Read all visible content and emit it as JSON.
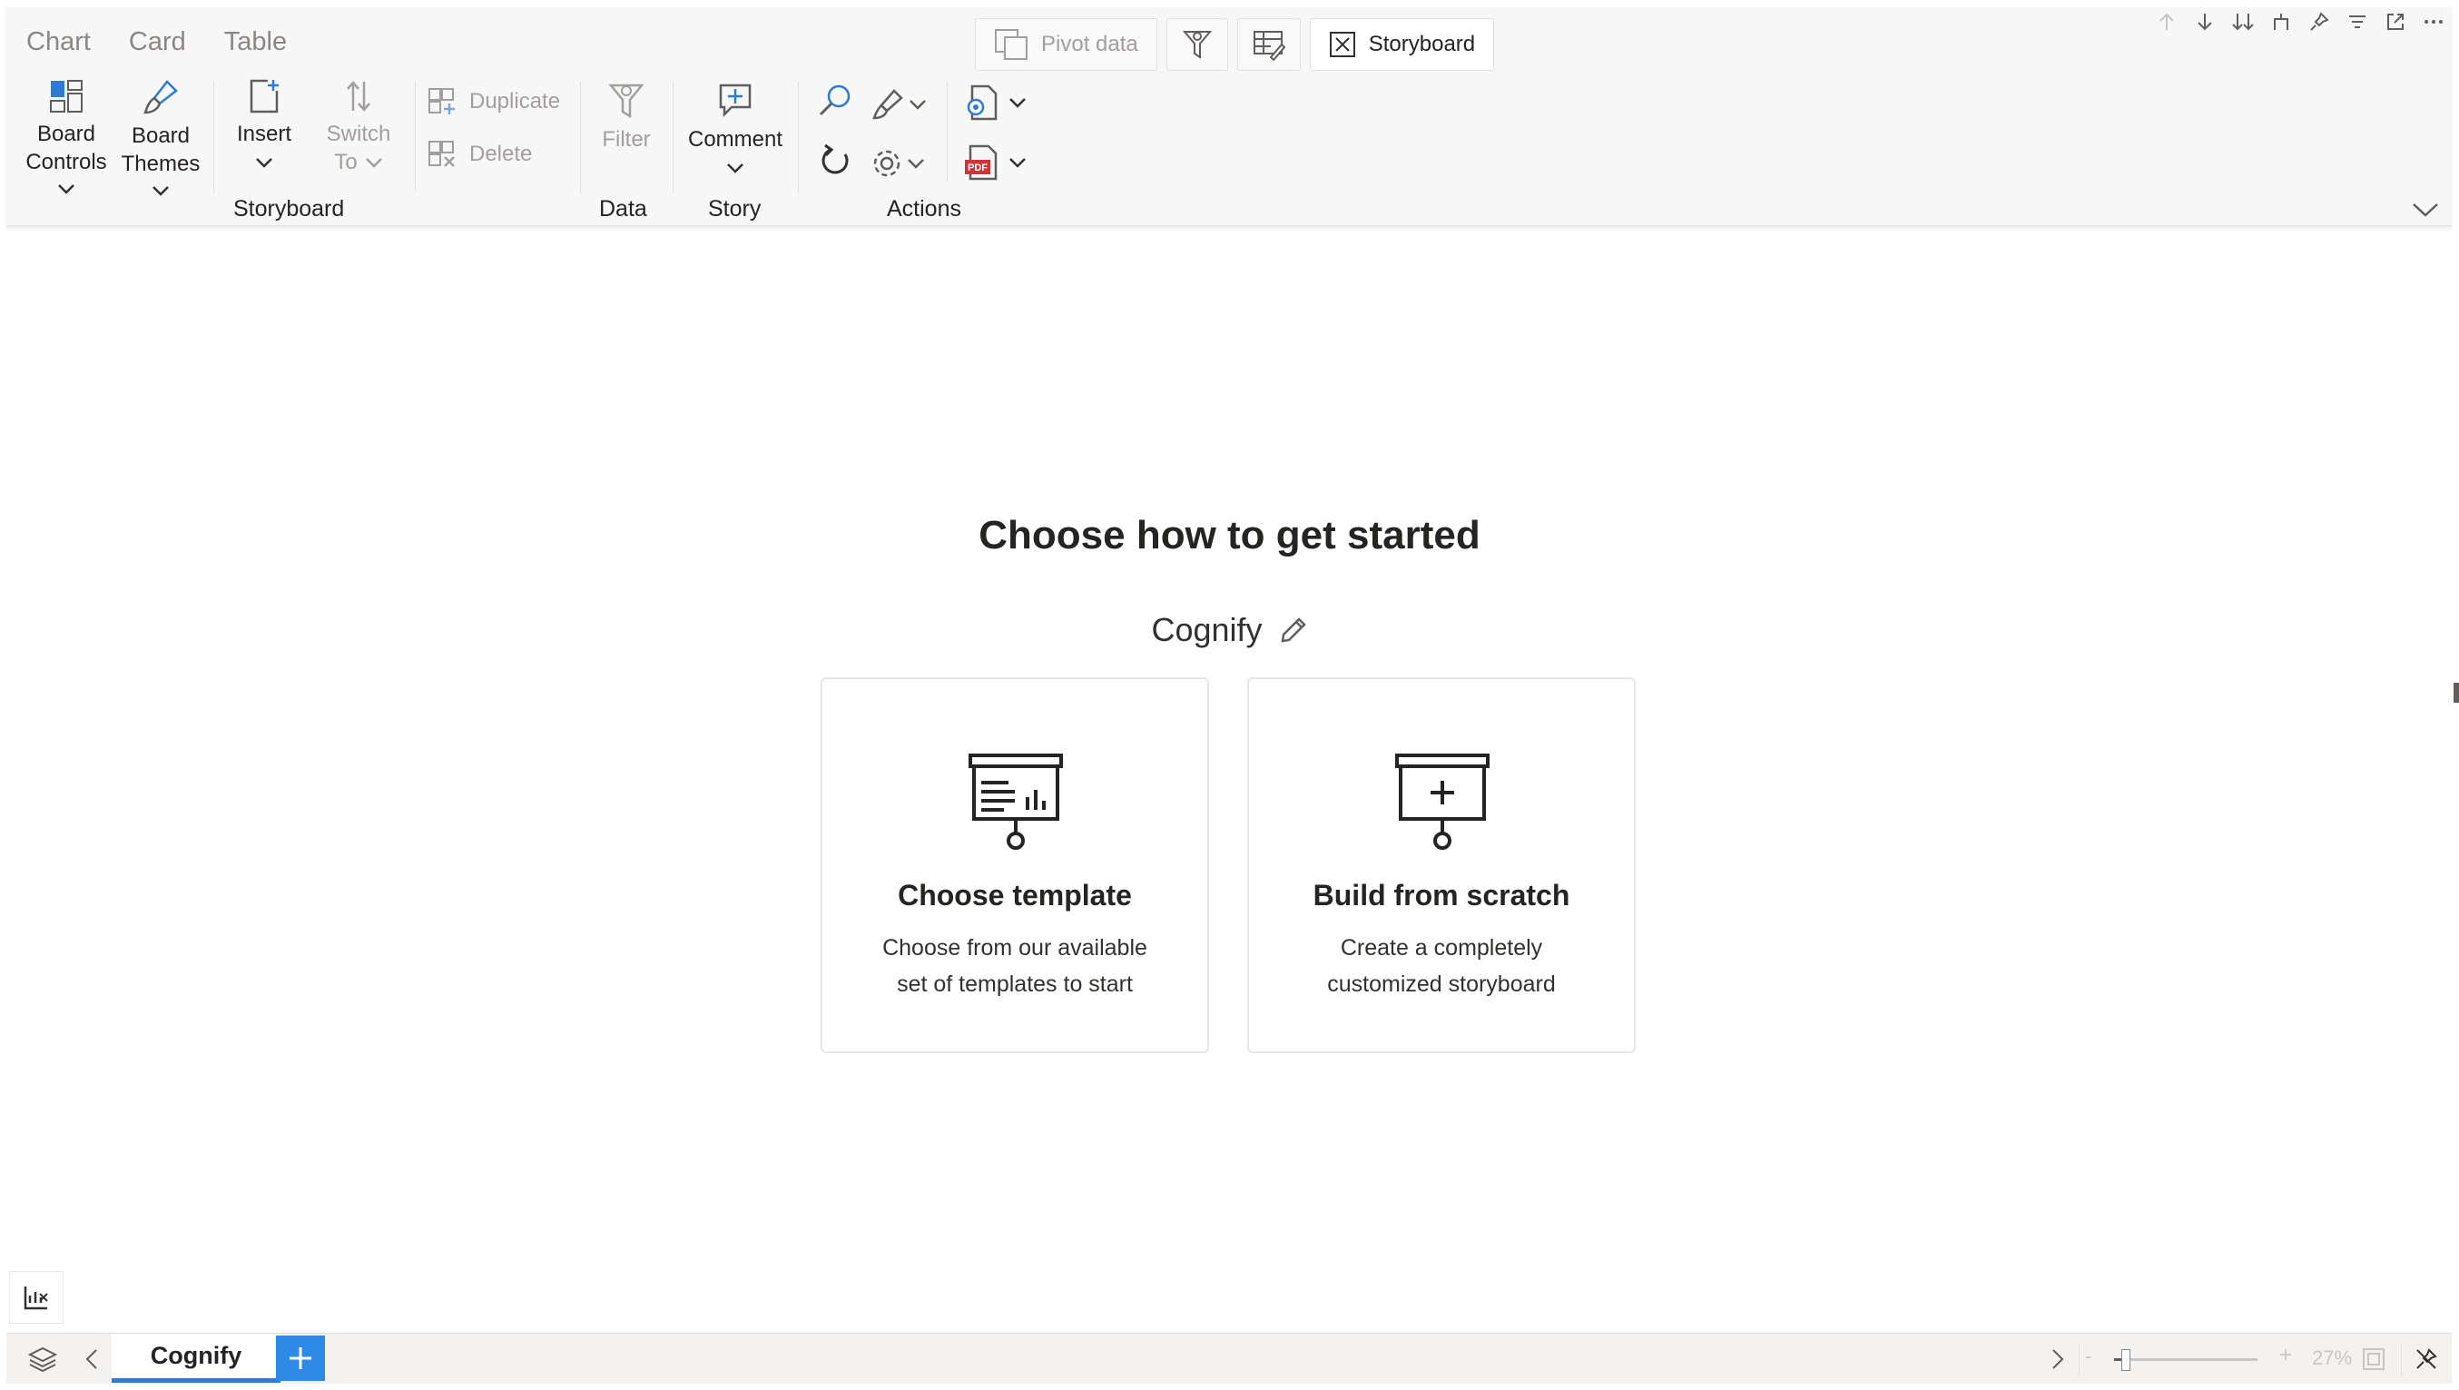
{
  "top_tabs": [
    "Chart",
    "Card",
    "Table"
  ],
  "center_tools": {
    "pivot_label": "Pivot data",
    "storyboard_label": "Storyboard"
  },
  "ribbon": {
    "board_controls": [
      "Board",
      "Controls"
    ],
    "board_themes": [
      "Board",
      "Themes"
    ],
    "insert": "Insert",
    "switch_to": [
      "Switch",
      "To"
    ],
    "duplicate": "Duplicate",
    "delete": "Delete",
    "filter": "Filter",
    "comment": "Comment",
    "groups": {
      "storyboard": "Storyboard",
      "data": "Data",
      "story": "Story",
      "actions": "Actions"
    }
  },
  "main": {
    "heading": "Choose how to get started",
    "story_name": "Cognify",
    "cards": [
      {
        "title": "Choose template",
        "desc_line1": "Choose from our available",
        "desc_line2": "set of templates to start"
      },
      {
        "title": "Build from scratch",
        "desc_line1": "Create a completely",
        "desc_line2": "customized storyboard"
      }
    ]
  },
  "status_bar": {
    "page_tab": "Cognify",
    "zoom_label": "27%",
    "zoom_level": 0.27
  },
  "colors": {
    "accent": "#2e8ae6",
    "pdf_red": "#d13438",
    "ribbon_bg": "#f7f7f7"
  },
  "icons": [
    "board-controls-icon",
    "brush-icon",
    "insert-icon",
    "switch-icon",
    "duplicate-icon",
    "delete-icon",
    "filter-icon",
    "comment-icon",
    "search-icon",
    "format-icon",
    "refresh-icon",
    "settings-icon",
    "export-settings-icon",
    "pdf-icon",
    "presentation-chart-icon",
    "presentation-add-icon",
    "pencil-icon",
    "layers-icon"
  ]
}
